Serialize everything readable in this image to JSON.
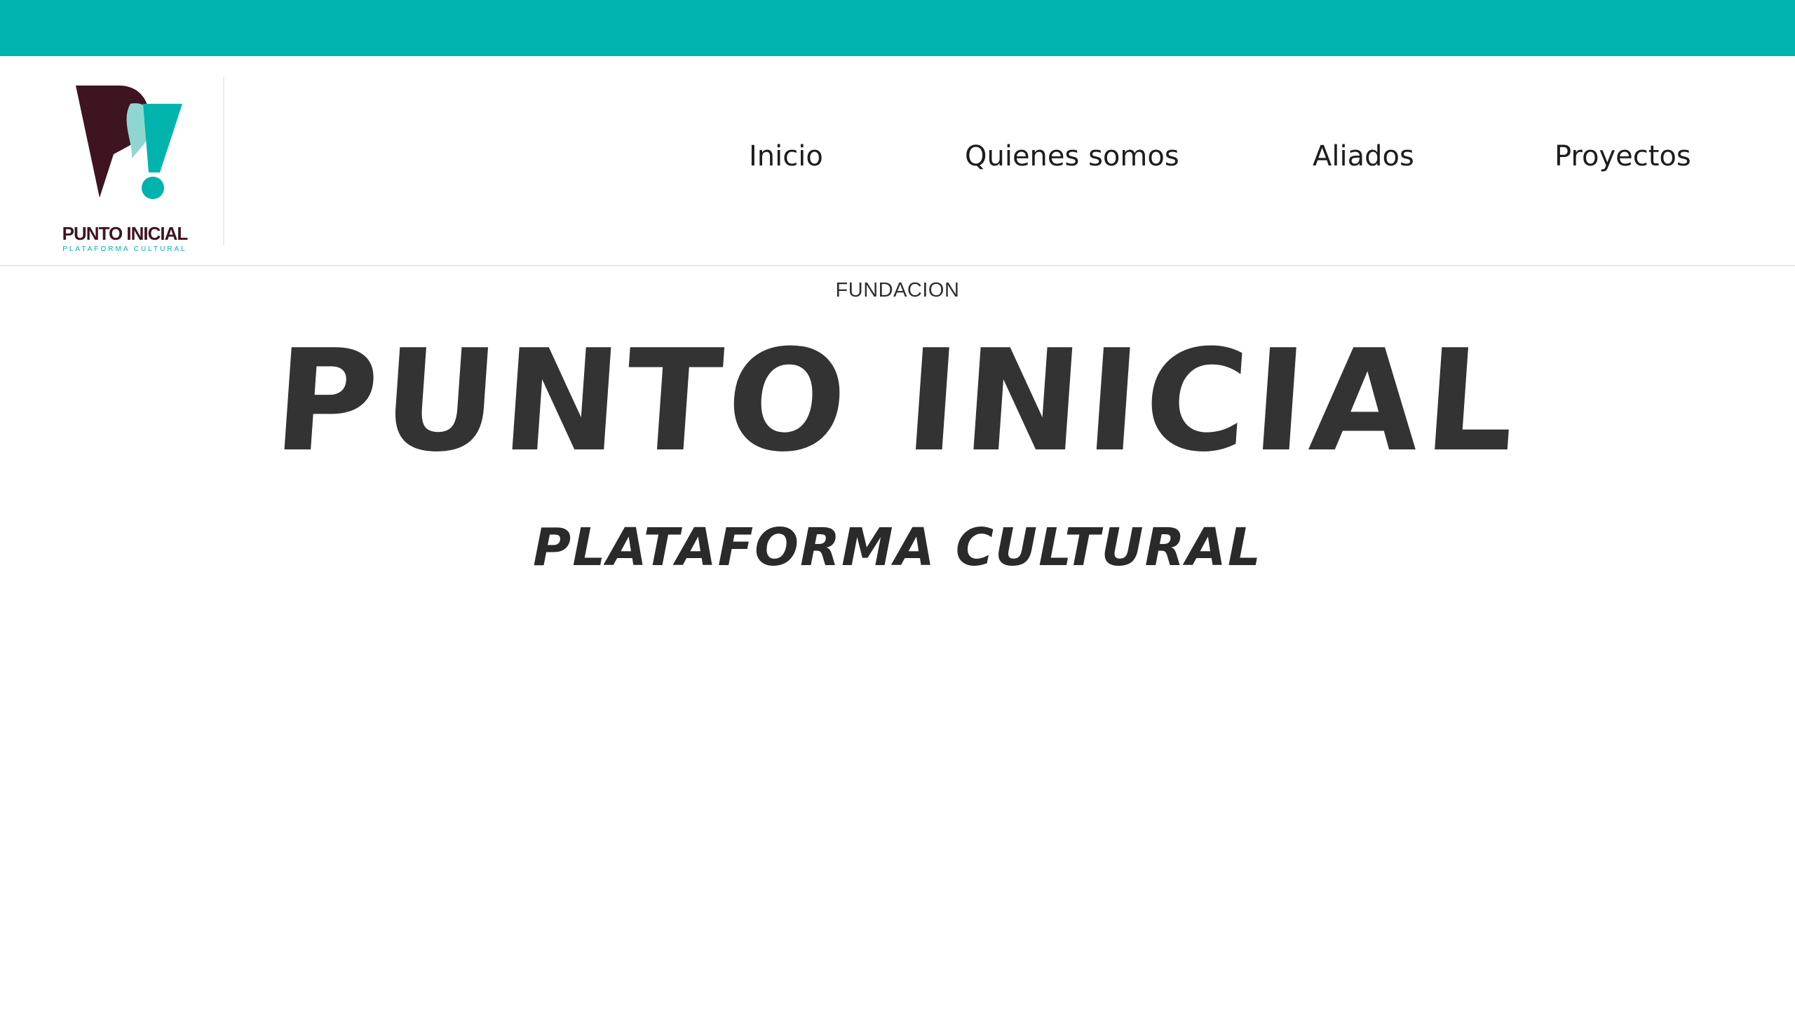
{
  "brand": {
    "name": "PUNTO INICIAL",
    "tagline": "PLATAFORMA CULTURAL",
    "colors": {
      "accent": "#00b3ad",
      "dark": "#3e1420",
      "light_accent": "#8fd6d1"
    }
  },
  "nav": {
    "items": [
      {
        "label": "Inicio"
      },
      {
        "label": "Quienes somos"
      },
      {
        "label": "Aliados"
      },
      {
        "label": "Proyectos"
      }
    ]
  },
  "hero": {
    "kicker": "FUNDACION",
    "title": "PUNTO INICIAL",
    "subtitle": "PLATAFORMA CULTURAL"
  }
}
